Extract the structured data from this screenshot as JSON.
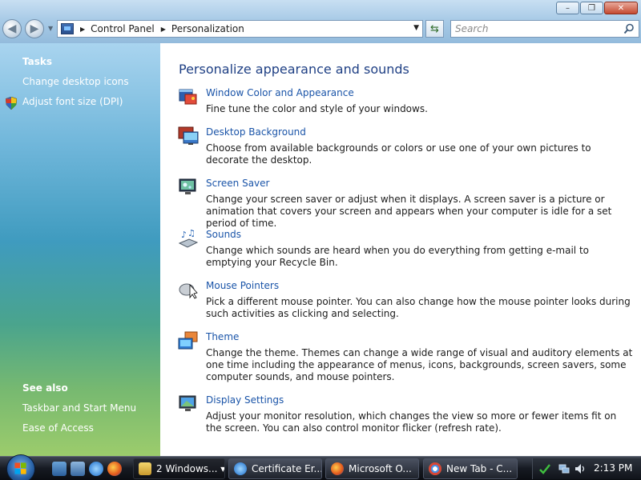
{
  "window": {
    "minimize_glyph": "–",
    "maximize_glyph": "❐",
    "close_glyph": "✕"
  },
  "address": {
    "breadcrumbs": [
      "Control Panel",
      "Personalization"
    ]
  },
  "search": {
    "placeholder": "Search"
  },
  "left_pane": {
    "tasks_heading": "Tasks",
    "tasks": [
      "Change desktop icons",
      "Adjust font size (DPI)"
    ],
    "see_also_heading": "See also",
    "see_also": [
      "Taskbar and Start Menu",
      "Ease of Access"
    ]
  },
  "main": {
    "title": "Personalize appearance and sounds",
    "items": [
      {
        "link": "Window Color and Appearance",
        "desc": "Fine tune the color and style of your windows.",
        "icon": "window-color-icon"
      },
      {
        "link": "Desktop Background",
        "desc": "Choose from available backgrounds or colors or use one of your own pictures to decorate the desktop.",
        "icon": "desktop-background-icon"
      },
      {
        "link": "Screen Saver",
        "desc": "Change your screen saver or adjust when it displays. A screen saver is a picture or animation that covers your screen and appears when your computer is idle for a set period of time.",
        "icon": "screen-saver-icon"
      },
      {
        "link": "Sounds",
        "desc": "Change which sounds are heard when you do everything from getting e-mail to emptying your Recycle Bin.",
        "icon": "sounds-icon"
      },
      {
        "link": "Mouse Pointers",
        "desc": "Pick a different mouse pointer. You can also change how the mouse pointer looks during such activities as clicking and selecting.",
        "icon": "mouse-pointers-icon"
      },
      {
        "link": "Theme",
        "desc": "Change the theme. Themes can change a wide range of visual and auditory elements at one time including the appearance of menus, icons, backgrounds, screen savers, some computer sounds, and mouse pointers.",
        "icon": "theme-icon"
      },
      {
        "link": "Display Settings",
        "desc": "Adjust your monitor resolution, which changes the view so more or fewer items fit on the screen. You can also control monitor flicker (refresh rate).",
        "icon": "display-settings-icon"
      }
    ]
  },
  "taskbar": {
    "buttons": [
      {
        "label": "2 Windows... ▾",
        "icon": "folder-icon"
      },
      {
        "label": "Certificate Er...",
        "icon": "ie-icon"
      },
      {
        "label": "Microsoft O...",
        "icon": "firefox-icon"
      },
      {
        "label": "New Tab - C...",
        "icon": "chrome-icon"
      }
    ],
    "clock": "2:13 PM"
  },
  "colors": {
    "link": "#1a54a8",
    "title": "#1e3f84",
    "left_pane_top": "#a9d4ef",
    "left_pane_bottom": "#9ccc6c"
  }
}
